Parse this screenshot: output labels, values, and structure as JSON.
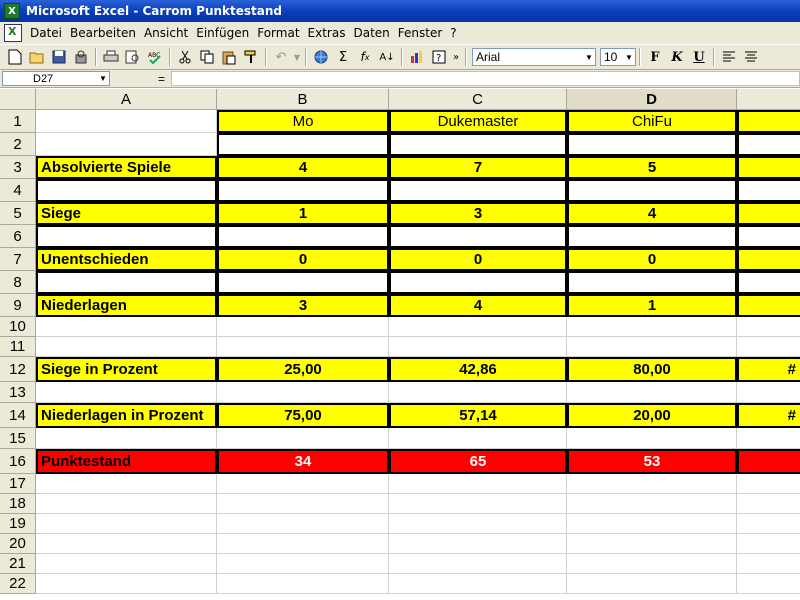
{
  "window": {
    "title": "Microsoft Excel - Carrom Punktestand"
  },
  "menu": [
    "Datei",
    "Bearbeiten",
    "Ansicht",
    "Einfügen",
    "Format",
    "Extras",
    "Daten",
    "Fenster",
    "?"
  ],
  "toolbar": {
    "font": "Arial",
    "size": "10"
  },
  "namebox": "D27",
  "formula_eq": "=",
  "columns": [
    "A",
    "B",
    "C",
    "D"
  ],
  "rows": [
    "1",
    "2",
    "3",
    "4",
    "5",
    "6",
    "7",
    "8",
    "9",
    "10",
    "11",
    "12",
    "13",
    "14",
    "15",
    "16",
    "17",
    "18",
    "19",
    "20",
    "21",
    "22"
  ],
  "sheet": {
    "r1": {
      "b": "Mo",
      "c": "Dukemaster",
      "d": "ChiFu"
    },
    "r3": {
      "a": "Absolvierte Spiele",
      "b": "4",
      "c": "7",
      "d": "5"
    },
    "r5": {
      "a": "Siege",
      "b": "1",
      "c": "3",
      "d": "4"
    },
    "r7": {
      "a": "Unentschieden",
      "b": "0",
      "c": "0",
      "d": "0"
    },
    "r9": {
      "a": "Niederlagen",
      "b": "3",
      "c": "4",
      "d": "1"
    },
    "r12": {
      "a": "Siege in Prozent",
      "b": "25,00",
      "c": "42,86",
      "d": "80,00",
      "e": "#"
    },
    "r14": {
      "a": "Niederlagen in Prozent",
      "b": "75,00",
      "c": "57,14",
      "d": "20,00",
      "e": "#"
    },
    "r16": {
      "a": "Punktestand",
      "b": "34",
      "c": "65",
      "d": "53"
    }
  }
}
